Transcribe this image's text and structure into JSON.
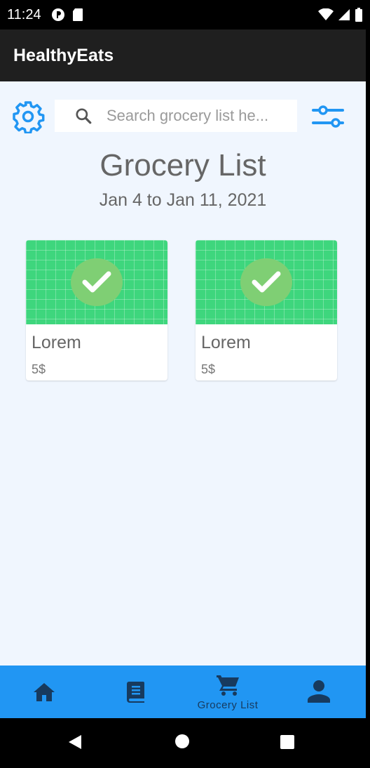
{
  "status_bar": {
    "time": "11:24"
  },
  "app_bar": {
    "title": "HealthyEats"
  },
  "search": {
    "placeholder": "Search grocery list he..."
  },
  "header": {
    "title": "Grocery List",
    "date_range": "Jan 4 to Jan 11, 2021"
  },
  "items": [
    {
      "name": "Lorem",
      "price": "5$"
    },
    {
      "name": "Lorem",
      "price": "5$"
    }
  ],
  "bottom_nav": {
    "items": [
      {
        "icon": "home-icon",
        "label": ""
      },
      {
        "icon": "book-icon",
        "label": ""
      },
      {
        "icon": "cart-icon",
        "label": "Grocery List",
        "active": true
      },
      {
        "icon": "person-icon",
        "label": ""
      }
    ]
  },
  "colors": {
    "accent": "#2196f3",
    "nav_icon": "#173a5e",
    "card_image": "#3ed67d",
    "check_circle": "#7fcf74",
    "app_bar": "#1f1f1f",
    "background": "#f0f6fe"
  }
}
